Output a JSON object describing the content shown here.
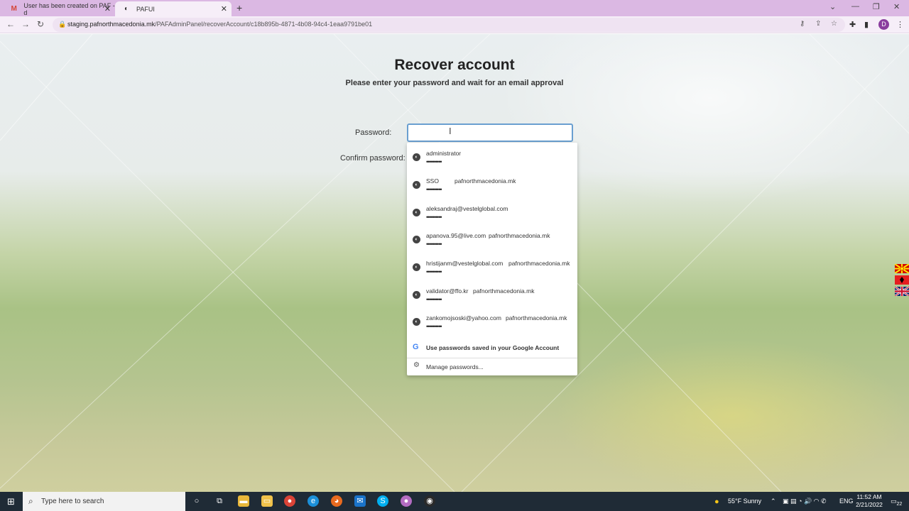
{
  "browser": {
    "tabs": [
      {
        "title": "User has been created on PAF - d",
        "active": false
      },
      {
        "title": "PAFUI",
        "active": true
      }
    ],
    "url_host": "staging.pafnorthmacedonia.mk",
    "url_path": "/PAFAdminPanel/recoverAccount/c18b895b-4871-4b08-94c4-1eaa9791be01",
    "profile_initial": "D"
  },
  "page": {
    "title": "Recover account",
    "subtitle": "Please enter your password and wait for an email approval",
    "password_label": "Password:",
    "confirm_label": "Confirm password:",
    "password_value": ""
  },
  "autofill": {
    "entries": [
      {
        "user": "administrator",
        "site": "",
        "dots": "••••••••••"
      },
      {
        "user": "SSO",
        "site": "pafnorthmacedonia.mk",
        "dots": "••••••••••"
      },
      {
        "user": "aleksandraj@vestelglobal.com",
        "site": "",
        "dots": "••••••••••"
      },
      {
        "user": "apanova.95@live.com",
        "site": "pafnorthmacedonia.mk",
        "dots": "••••••••••"
      },
      {
        "user": "hristijanm@vestelglobal.com",
        "site": "pafnorthmacedonia.mk",
        "dots": "••••••••••"
      },
      {
        "user": "validator@ffo.kr",
        "site": "pafnorthmacedonia.mk",
        "dots": "••••••••••"
      },
      {
        "user": "zankomojsoski@yahoo.com",
        "site": "pafnorthmacedonia.mk",
        "dots": "••••••••••"
      }
    ],
    "google_option": "Use passwords saved in your Google Account",
    "manage": "Manage passwords..."
  },
  "taskbar": {
    "search_placeholder": "Type here to search",
    "weather": "55°F  Sunny",
    "language": "ENG",
    "time": "11:52 AM",
    "date": "2/21/2022",
    "notifications": "22"
  },
  "colors": {
    "tabbar": "#dbb8e3",
    "focus_border": "#6a9fd0",
    "taskbar": "#1f2b36"
  }
}
